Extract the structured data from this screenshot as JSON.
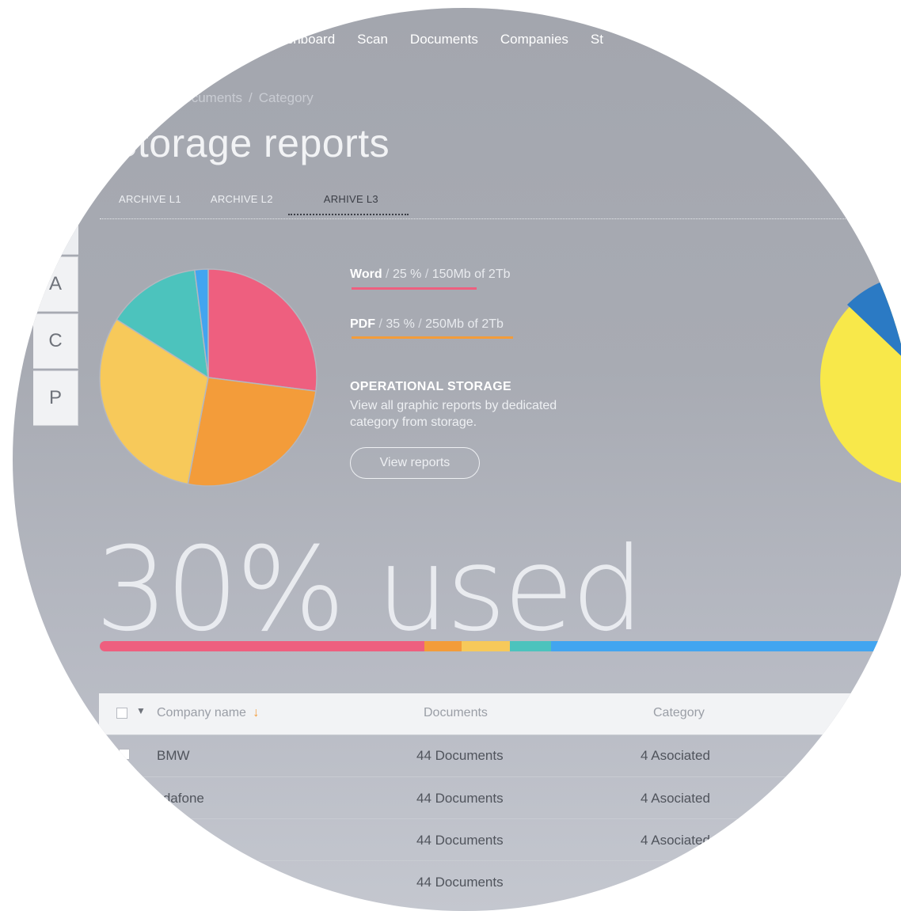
{
  "nav": {
    "items": [
      "Dashboard",
      "Scan",
      "Documents",
      "Companies",
      "St"
    ]
  },
  "breadcrumb": {
    "parent": "Documents",
    "current": "Category"
  },
  "page_title": "Storage reports",
  "tabs": [
    {
      "label": "ARCHIVE L1",
      "active": false
    },
    {
      "label": "ARCHIVE L2",
      "active": false
    },
    {
      "label": "ARHIVE L3",
      "active": true
    }
  ],
  "letters": [
    "A",
    "C",
    "P"
  ],
  "legend": [
    {
      "name": "Word",
      "percent": "25 %",
      "size": "150Mb",
      "of_total": "of 2Tb",
      "color": "#ee5f7f"
    },
    {
      "name": "PDF",
      "percent": "35 %",
      "size": "250Mb",
      "of_total": "of 2Tb",
      "color": "#f39c3a"
    }
  ],
  "operational": {
    "title": "OPERATIONAL STORAGE",
    "text": "View all graphic reports by dedicated category from storage.",
    "button": "View reports"
  },
  "usage": {
    "label": "30% used",
    "percent": 30,
    "segments": [
      {
        "color": "#ee5f7f",
        "fraction": 0.41
      },
      {
        "color": "#f39c3a",
        "fraction": 0.047
      },
      {
        "color": "#f7c95a",
        "fraction": 0.061
      },
      {
        "color": "#4cc3bd",
        "fraction": 0.052
      },
      {
        "color": "#42a5f0",
        "fraction": 0.43
      }
    ]
  },
  "pie_main": [
    {
      "color": "#ee5f7f",
      "value": 27
    },
    {
      "color": "#f39c3a",
      "value": 26
    },
    {
      "color": "#f7c95a",
      "value": 31
    },
    {
      "color": "#4cc3bd",
      "value": 14
    },
    {
      "color": "#42a5f0",
      "value": 2
    }
  ],
  "table": {
    "headers": {
      "company": "Company name",
      "documents": "Documents",
      "category": "Category"
    },
    "rows": [
      {
        "company": "BMW",
        "documents": "44 Documents",
        "category": "4 Asociated"
      },
      {
        "company": "Vodafone",
        "documents": "44 Documents",
        "category": "4 Asociated"
      },
      {
        "company": "",
        "documents": "44 Documents",
        "category": "4 Asociated"
      },
      {
        "company": "",
        "documents": "44 Documents",
        "category": ""
      }
    ]
  },
  "colors": {
    "accent_sort": "#f39c3a",
    "pie2_blue": "#2b7ac4",
    "pie2_yellow": "#f8e84a"
  }
}
